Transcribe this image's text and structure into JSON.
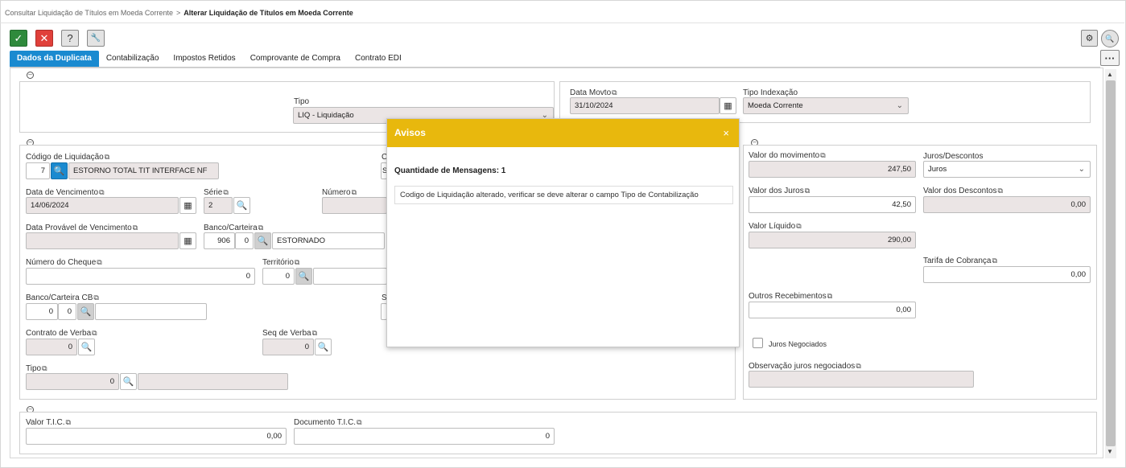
{
  "breadcrumb": {
    "parent": "Consultar Liquidação de Títulos em Moeda Corrente",
    "separator": ">",
    "current": "Alterar Liquidação de Títulos em Moeda Corrente"
  },
  "toolbar": {
    "confirm": "✓",
    "cancel": "✕",
    "help": "?",
    "tools": "🔧",
    "settings": "⚙",
    "search": "🔍",
    "more": "···"
  },
  "tabs": [
    {
      "label": "Dados da Duplicata",
      "active": true
    },
    {
      "label": "Contabilização"
    },
    {
      "label": "Impostos Retidos"
    },
    {
      "label": "Comprovante de Compra"
    },
    {
      "label": "Contrato EDI"
    }
  ],
  "header_section": {
    "tipo_label": "Tipo",
    "tipo_value": "LIQ - Liquidação",
    "data_movto_label": "Data Movto",
    "data_movto_value": "31/10/2024",
    "tipo_indexacao_label": "Tipo Indexação",
    "tipo_indexacao_value": "Moeda Corrente"
  },
  "left_section": {
    "codigo_liquidacao_label": "Código de Liquidação",
    "codigo_liquidacao_value": "7",
    "codigo_liquidacao_desc": "ESTORNO TOTAL TIT INTERFACE NF",
    "c_label": "C",
    "c_value": "S",
    "data_vencimento_label": "Data de Vencimento",
    "data_vencimento_value": "14/06/2024",
    "serie_label": "Série",
    "serie_value": "2",
    "numero_label": "Número",
    "data_provavel_label": "Data Provável de Vencimento",
    "banco_carteira_label": "Banco/Carteira",
    "banco_value": "906",
    "carteira_value": "0",
    "banco_desc": "ESTORNADO",
    "numero_cheque_label": "Número do Cheque",
    "numero_cheque_value": "0",
    "territorio_label": "Território",
    "territorio_value": "0",
    "banco_carteira_cb_label": "Banco/Carteira CB",
    "banco_cb_value": "0",
    "carteira_cb_value": "0",
    "s_label": "S",
    "contrato_verba_label": "Contrato de Verba",
    "contrato_verba_value": "0",
    "seq_verba_label": "Seq de Verba",
    "seq_verba_value": "0",
    "tipo_label": "Tipo",
    "tipo_value": "0"
  },
  "right_section": {
    "valor_movimento_label": "Valor do movimento",
    "valor_movimento_value": "247,50",
    "juros_descontos_label": "Juros/Descontos",
    "juros_descontos_value": "Juros",
    "valor_juros_label": "Valor dos Juros",
    "valor_juros_value": "42,50",
    "valor_descontos_label": "Valor dos Descontos",
    "valor_descontos_value": "0,00",
    "valor_liquido_label": "Valor Líquido",
    "valor_liquido_value": "290,00",
    "tarifa_cobranca_label": "Tarifa de Cobrança",
    "tarifa_cobranca_value": "0,00",
    "outros_recebimentos_label": "Outros Recebimentos",
    "outros_recebimentos_value": "0,00",
    "juros_negociados_label": "Juros Negociados",
    "obs_juros_label": "Observação juros negociados"
  },
  "bottom_section": {
    "valor_tic_label": "Valor T.I.C.",
    "valor_tic_value": "0,00",
    "documento_tic_label": "Documento T.I.C.",
    "documento_tic_value": "0"
  },
  "modal": {
    "title": "Avisos",
    "close": "×",
    "count_text": "Quantidade de Mensagens: 1",
    "message": "Codigo de Liquidação alterado, verificar se deve alterar o campo Tipo de Contabilização"
  },
  "colors": {
    "primary": "#1a8ad0",
    "confirm": "#2f8a3c",
    "cancel": "#e0403a",
    "modal_header": "#e8b80d",
    "readonly": "#ebe5e5"
  }
}
